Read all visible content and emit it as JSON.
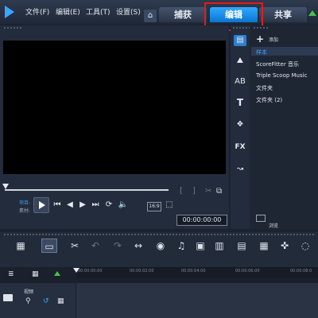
{
  "menu": {
    "file": "文件(F)",
    "edit": "编辑(E)",
    "tools": "工具(T)",
    "settings": "设置(S)"
  },
  "tabs": {
    "capture": "捕获",
    "edit": "编辑",
    "share": "共享"
  },
  "library": {
    "add_label": "添加",
    "items": [
      "样本",
      "ScoreFitter 音乐",
      "Triple Scoop Music",
      "文件夹",
      "文件夹 (2)"
    ],
    "browse_label": "浏览"
  },
  "player": {
    "mode_project": "项目-",
    "mode_clip": "素材-",
    "aspect": "16:9",
    "timecode": "00:00:00:00"
  },
  "timeline": {
    "ruler_ticks": [
      "00:00:00:00",
      "00:00:02:00",
      "00:00:04:00",
      "00:00:06:00",
      "00:00:08:0"
    ],
    "track_label": "视频"
  },
  "colors": {
    "accent": "#1e90ff",
    "highlight_box": "#e21b1b",
    "bg": "#1b2230"
  }
}
